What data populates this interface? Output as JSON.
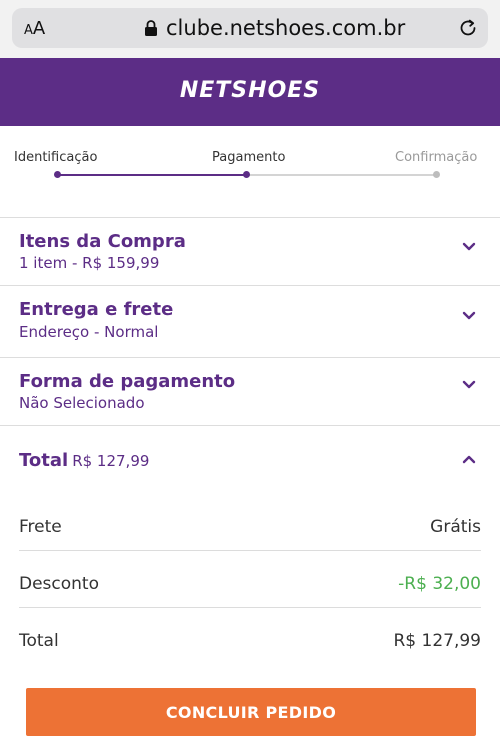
{
  "browser": {
    "text_size_label_small": "A",
    "text_size_label_large": "A",
    "url": "clube.netshoes.com.br"
  },
  "header": {
    "logo_text": "NETSHOES"
  },
  "steps": [
    {
      "label": "Identificação"
    },
    {
      "label": "Pagamento"
    },
    {
      "label": "Confirmação"
    }
  ],
  "sections": {
    "items": {
      "title": "Itens da Compra",
      "subtitle": "1 item - R$ 159,99"
    },
    "delivery": {
      "title": "Entrega e frete",
      "subtitle": "Endereço - Normal"
    },
    "payment": {
      "title": "Forma de pagamento",
      "subtitle": "Não Selecionado"
    }
  },
  "summary": {
    "total_label": "Total",
    "total_value": "R$ 127,99",
    "rows": [
      {
        "label": "Frete",
        "value": "Grátis"
      },
      {
        "label": "Desconto",
        "value": "-R$ 32,00"
      },
      {
        "label": "Total",
        "value": "R$ 127,99"
      }
    ]
  },
  "actions": {
    "submit_label": "CONCLUIR PEDIDO"
  },
  "colors": {
    "brand": "#5c2d86",
    "cta": "#ed7235",
    "discount": "#4caf50"
  }
}
